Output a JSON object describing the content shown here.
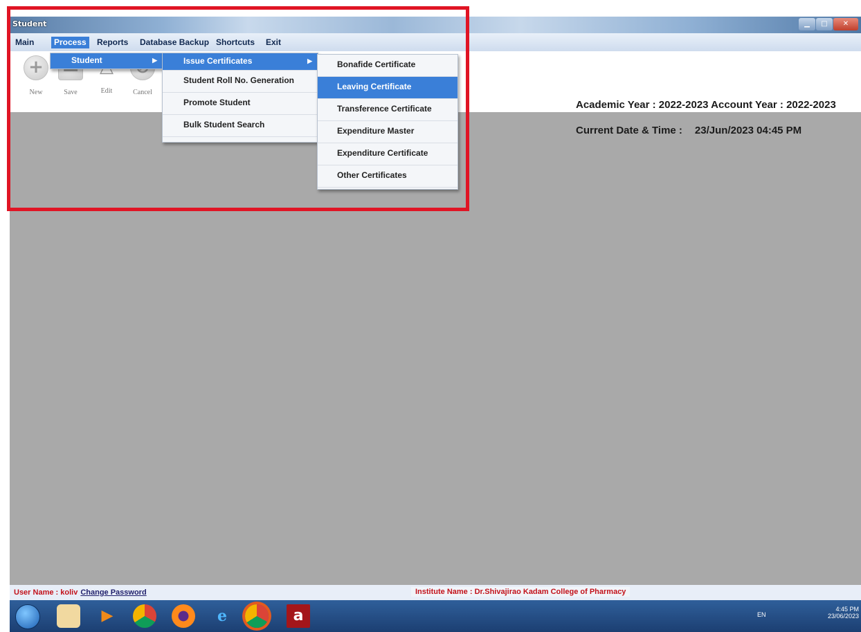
{
  "window": {
    "title": "Student"
  },
  "menubar": {
    "items": [
      "Main",
      "Process",
      "Reports",
      "Database Backup",
      "Shortcuts",
      "Exit"
    ],
    "active": "Process"
  },
  "toolbar": {
    "buttons": [
      {
        "label": "New",
        "icon": "plus-icon"
      },
      {
        "label": "Save",
        "icon": "save-icon"
      },
      {
        "label": "Edit",
        "icon": "edit-icon"
      },
      {
        "label": "Cancel",
        "icon": "cancel-icon"
      }
    ]
  },
  "info": {
    "academic": "Academic Year : 2022-2023 Account Year : 2022-2023",
    "datetime_label": "Current Date & Time :",
    "datetime_value": "23/Jun/2023 04:45 PM"
  },
  "menus": {
    "process": {
      "items": [
        "Student"
      ]
    },
    "student": {
      "items": [
        "Issue Certificates",
        "Student Roll No. Generation",
        "Promote Student",
        "Bulk Student Search"
      ]
    },
    "certificates": {
      "items": [
        "Bonafide Certificate",
        "Leaving Certificate",
        "Transference Certificate",
        "Expenditure Master",
        "Expenditure Certificate",
        "Other Certificates"
      ],
      "highlighted": "Leaving Certificate"
    }
  },
  "statusbar": {
    "user": "User Name : koliv",
    "change_password": "Change Password",
    "institute": "Institute Name : Dr.Shivajirao Kadam College of Pharmacy"
  },
  "taskbar": {
    "apps": [
      "explorer-icon",
      "media-player-icon",
      "chrome-icon",
      "firefox-icon",
      "internet-explorer-icon",
      "chrome-icon",
      "app-a-icon"
    ],
    "app_a_letter": "a",
    "tray": {
      "lang": "EN",
      "time": "4:45 PM",
      "date": "23/06/2023"
    }
  },
  "colors": {
    "highlight_border": "#e01424",
    "menu_highlight": "#3a7fd8",
    "status_text": "#c2121b"
  }
}
